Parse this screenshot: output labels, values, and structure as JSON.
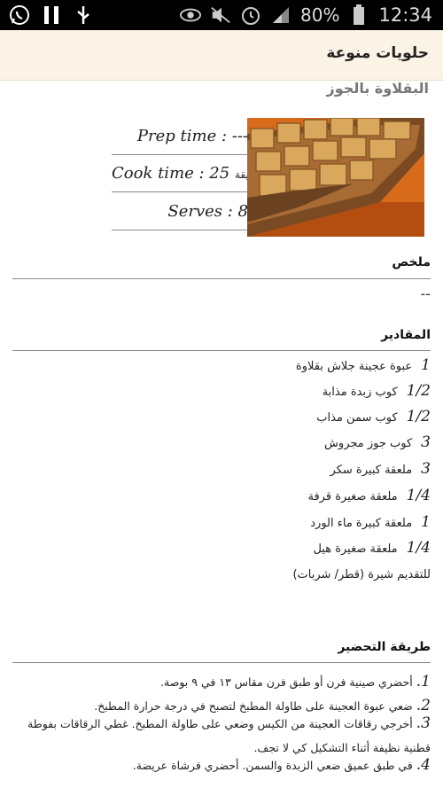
{
  "status_bar": {
    "left_icons": [
      "whatsapp-icon",
      "pause-icon",
      "usb-icon"
    ],
    "right_icons": [
      "eye-icon",
      "mute-icon",
      "alarm-icon",
      "signal-icon"
    ],
    "battery_percent": "80%",
    "time": "12:34"
  },
  "app_bar": {
    "title": "حلويات منوعة"
  },
  "recipe": {
    "name": "البقلاوة بالجوز",
    "prep_label": "Prep time : ---",
    "cook_label": "Cook time : 25",
    "cook_unit": "دقيقة",
    "serves_label": "Serves : 8",
    "summary_title": "ملخص",
    "summary_text": "--",
    "ingredients_title": "المقادير",
    "ingredients": [
      {
        "qty": "1",
        "text": "عبوة عجينة جلاش بقلاوة"
      },
      {
        "qty": "1/2",
        "text": "كوب زبدة مذابة"
      },
      {
        "qty": "1/2",
        "text": "كوب سمن مذاب"
      },
      {
        "qty": "3",
        "text": "كوب جوز مجروش"
      },
      {
        "qty": "3",
        "text": "ملعقة كبيرة سكر"
      },
      {
        "qty": "1/4",
        "text": "ملعقة صغيرة قرفة"
      },
      {
        "qty": "1",
        "text": "ملعقة كبيرة ماء الورد"
      },
      {
        "qty": "1/4",
        "text": "ملعقة صغيرة هيل"
      }
    ],
    "serve_note": "للتقديم شيرة (قطر/ شربات)",
    "directions_title": "طريقة التحضير",
    "steps": [
      {
        "num": "1.",
        "text": "أحضري صينية فرن أو طبق فرن مقاس ١٣ في ٩ بوصة."
      },
      {
        "num": "2.",
        "text": "ضعي عبوة العجينة على طاولة المطبخ لتصبح في درجة حرارة المطبخ."
      },
      {
        "num": "3.",
        "text": "أخرجي رقاقات العجينة من الكيس وضعي على طاولة المطبخ. غطي الرقاقات بفوطة قطنية نظيفة أثناء التشكيل كي لا تجف."
      },
      {
        "num": "4.",
        "text": "في طبق عميق ضعي الزبدة والسمن. أحضري فرشاة عريضة."
      }
    ]
  }
}
